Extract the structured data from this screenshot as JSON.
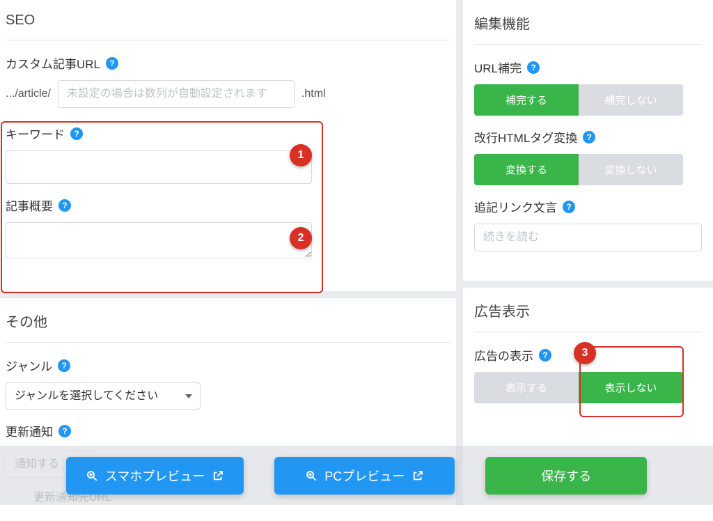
{
  "seo": {
    "title": "SEO",
    "custom_url": {
      "label": "カスタム記事URL",
      "prefix": ".../article/",
      "placeholder": "未設定の場合は数列が自動設定されます",
      "suffix": ".html"
    },
    "keyword": {
      "label": "キーワード"
    },
    "summary": {
      "label": "記事概要"
    }
  },
  "other": {
    "title": "その他",
    "genre": {
      "label": "ジャンル",
      "select_placeholder": "ジャンルを選択してください"
    },
    "update_notify": {
      "label": "更新通知",
      "select_value": "通知する",
      "url_label": "更新通知先URL"
    }
  },
  "edit": {
    "title": "編集機能",
    "url_complete": {
      "label": "URL補完",
      "on": "補完する",
      "off": "補完しない"
    },
    "html_convert": {
      "label": "改行HTMLタグ変換",
      "on": "変換する",
      "off": "変換しない"
    },
    "append_link": {
      "label": "追記リンク文言",
      "placeholder": "続きを読む"
    }
  },
  "ads": {
    "title": "広告表示",
    "display": {
      "label": "広告の表示",
      "on": "表示する",
      "off": "表示しない"
    }
  },
  "actions": {
    "mobile_preview": "スマホプレビュー",
    "pc_preview": "PCプレビュー",
    "save": "保存する"
  },
  "callouts": {
    "c1": "1",
    "c2": "2",
    "c3": "3"
  },
  "help_glyph": "?"
}
